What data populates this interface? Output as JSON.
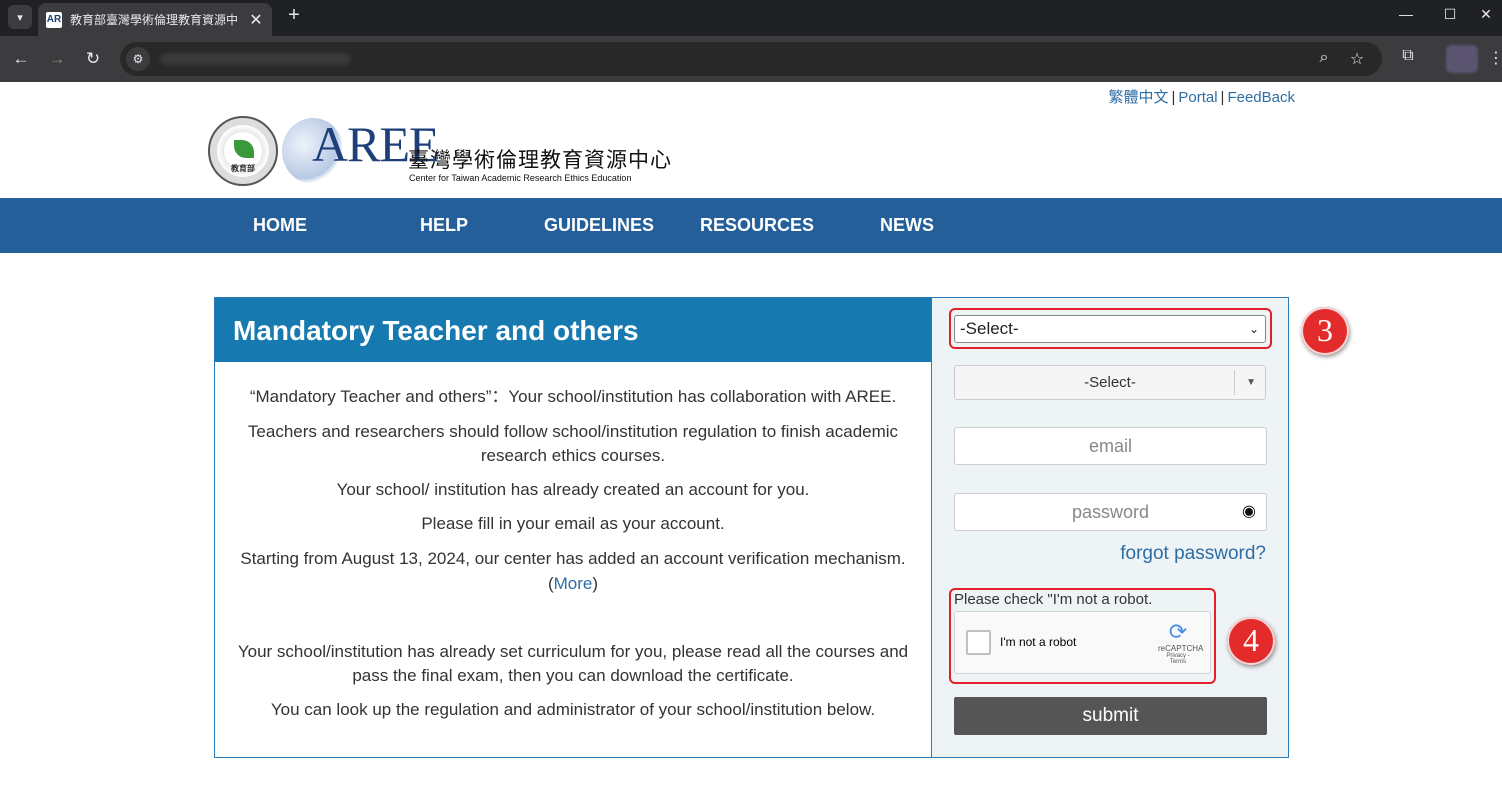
{
  "browser": {
    "tab_title": "教育部臺灣學術倫理教育資源中",
    "tab_favicon": "AR",
    "new_tab_symbol": "+",
    "close_symbol": "✕",
    "window_controls": [
      "—",
      "☐",
      "✕"
    ]
  },
  "page": {
    "top_links": {
      "lang": "繁體中文",
      "portal": "Portal",
      "feedback": "FeedBack",
      "separator": "|"
    },
    "logo": {
      "aree": "AREE",
      "center_cn": "臺灣學術倫理教育資源中心",
      "center_en": "Center for Taiwan Academic Research Ethics Education",
      "moe_text": "教育部"
    },
    "nav": [
      "HOME",
      "HELP",
      "GUIDELINES",
      "RESOURCES",
      "NEWS"
    ],
    "section": {
      "title": "Mandatory Teacher and others",
      "paragraphs": [
        "“Mandatory Teacher and others”：Your school/institution has collaboration with AREE.",
        "Teachers and researchers should follow school/institution regulation to finish academic research ethics courses.",
        "Your school/ institution has already created an account for you.",
        "Please fill in your email as your account.",
        "Starting from August 13, 2024, our center has added an account verification mechanism.",
        "Your school/institution has already set curriculum for you, please read all the courses and pass the final exam, then you can download the certificate.",
        "You can look up the regulation and administrator of your school/institution below."
      ],
      "more_open": "(",
      "more_link": "More",
      "more_close": ")"
    },
    "form": {
      "select1_value": "-Select-",
      "select2_value": "-Select-",
      "email_placeholder": "email",
      "password_placeholder": "password",
      "forgot_password": "forgot password?",
      "robot_prompt": "Please check \"I'm not a robot.",
      "recaptcha_label": "I'm not a robot",
      "recaptcha_brand": "reCAPTCHA",
      "recaptcha_terms": "Privacy - Terms",
      "submit": "submit"
    },
    "annotations": {
      "badge_3": "3",
      "badge_4": "4"
    }
  },
  "colors": {
    "nav_bg": "#245f9a",
    "section_head": "#1679b0",
    "link": "#2e6da4",
    "highlight": "#e2202a",
    "submit_bg": "#555555"
  }
}
